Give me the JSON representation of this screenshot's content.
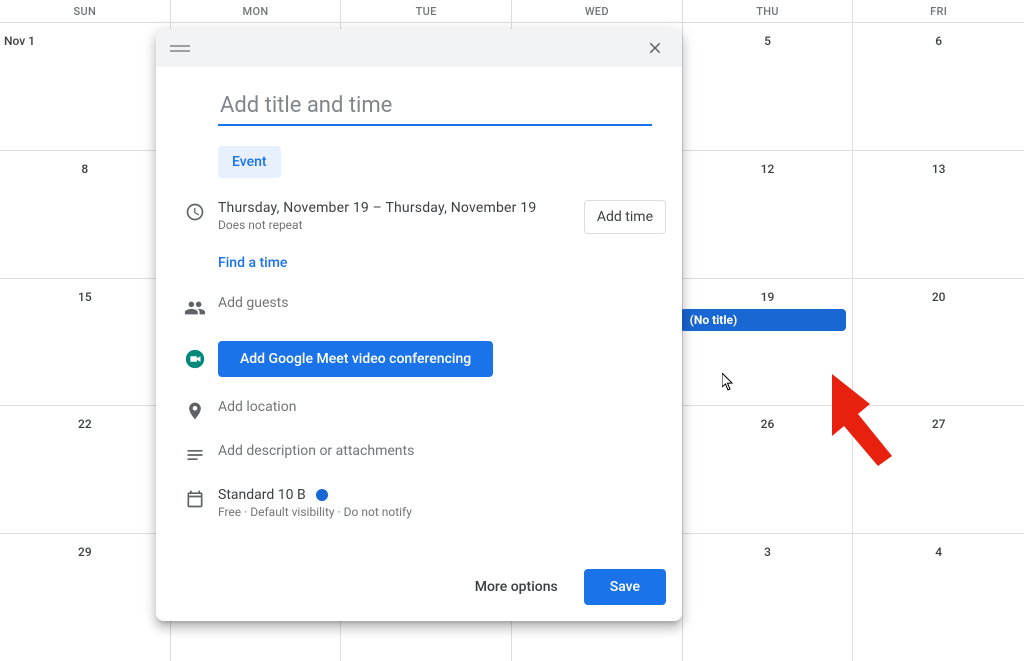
{
  "day_headers": [
    "SUN",
    "MON",
    "TUE",
    "WED",
    "THU",
    "FRI"
  ],
  "weeks": [
    [
      "Nov 1",
      "",
      "",
      "",
      "5",
      "6"
    ],
    [
      "8",
      "",
      "",
      "",
      "12",
      "13"
    ],
    [
      "15",
      "",
      "",
      "",
      "19",
      "20"
    ],
    [
      "22",
      "",
      "",
      "",
      "26",
      "27"
    ],
    [
      "29",
      "",
      "",
      "",
      "3",
      "4"
    ]
  ],
  "event_chip": {
    "label": "(No title)"
  },
  "modal": {
    "title_placeholder": "Add title and time",
    "tab_event": "Event",
    "date_start": "Thursday, November 19",
    "date_sep": "  –  ",
    "date_end": "Thursday, November 19",
    "does_not_repeat": "Does not repeat",
    "add_time": "Add time",
    "find_time": "Find a time",
    "add_guests": "Add guests",
    "meet_button": "Add Google Meet video conferencing",
    "add_location": "Add location",
    "add_description": "Add description or attachments",
    "calendar_name": "Standard 10 B",
    "calendar_sub": "Free · Default visibility · Do not notify",
    "more_options": "More options",
    "save": "Save"
  }
}
